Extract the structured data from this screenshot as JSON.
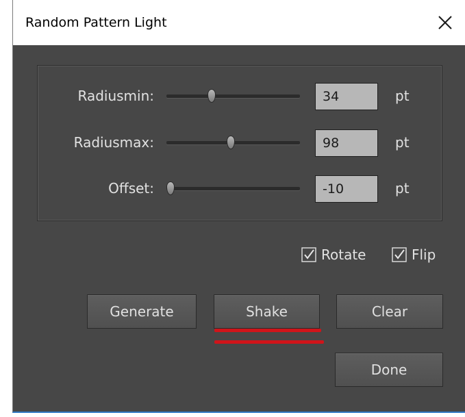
{
  "window": {
    "title": "Random Pattern Light"
  },
  "params": [
    {
      "label": "Radiusmin:",
      "value": "34",
      "unit": "pt",
      "slider_fraction": 0.33
    },
    {
      "label": "Radiusmax:",
      "value": "98",
      "unit": "pt",
      "slider_fraction": 0.48
    },
    {
      "label": "Offset:",
      "value": "-10",
      "unit": "pt",
      "slider_fraction": 0.0
    }
  ],
  "options": {
    "rotate": {
      "label": "Rotate",
      "checked": true
    },
    "flip": {
      "label": "Flip",
      "checked": true
    }
  },
  "buttons": {
    "generate": "Generate",
    "shake": "Shake",
    "clear": "Clear",
    "done": "Done"
  },
  "colors": {
    "panel_bg": "#474747",
    "annotation_underline": "#d0141a"
  }
}
